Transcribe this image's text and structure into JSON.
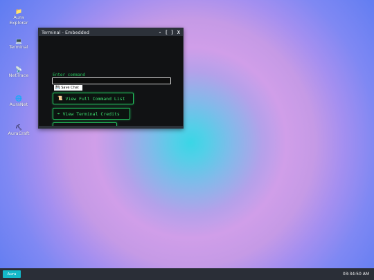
{
  "desktop": {
    "icons": [
      {
        "label": "Aura\nExplorer",
        "icon": "folder-icon",
        "glyph": "📁"
      },
      {
        "label": "Terminal",
        "icon": "terminal-icon",
        "glyph": "💻"
      },
      {
        "label": "NetTrace",
        "icon": "network-icon",
        "glyph": "📡"
      },
      {
        "label": "AuraNet",
        "icon": "globe-icon",
        "glyph": "🌐"
      },
      {
        "label": "AuraCraft",
        "icon": "pickaxe-icon",
        "glyph": "⛏"
      }
    ]
  },
  "window": {
    "title": "Terminal - Embedded",
    "controls": {
      "minimize": "-",
      "maximize": "[ ]",
      "close": "X"
    },
    "prompt_label": "Enter command",
    "input_value": "",
    "save_chat": {
      "icon": "💾",
      "label": "Save Chat"
    },
    "buttons": [
      {
        "icon": "📜",
        "label": "View Full Command List"
      },
      {
        "icon": "✒",
        "label": "View Terminal Credits"
      }
    ]
  },
  "taskbar": {
    "start_label": "Aura",
    "clock": "03:34:50 AM"
  },
  "colors": {
    "accent": "#14b8c8",
    "terminal_green": "#22c55e",
    "window_bg": "#111214",
    "titlebar_bg": "#2c3139",
    "taskbar_bg": "#2a2e37"
  }
}
